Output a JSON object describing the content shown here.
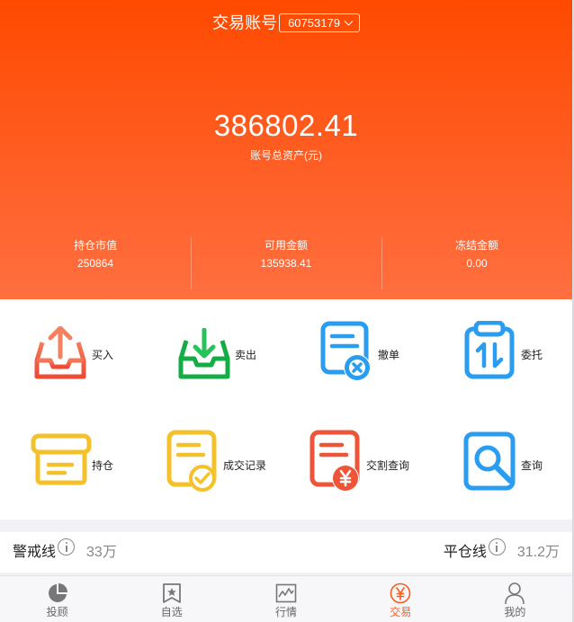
{
  "header": {
    "title": "交易账号",
    "account_number": "60753179"
  },
  "assets": {
    "total_value": "386802.41",
    "total_label": "账号总资产(元)",
    "stats": [
      {
        "label": "持仓市值",
        "value": "250864"
      },
      {
        "label": "可用金额",
        "value": "135938.41"
      },
      {
        "label": "冻结金额",
        "value": "0.00"
      }
    ]
  },
  "actions": [
    {
      "label": "买入",
      "icon": "buy-tray-up-icon",
      "color": "#f05a3c"
    },
    {
      "label": "卖出",
      "icon": "sell-tray-down-icon",
      "color": "#1fb44a"
    },
    {
      "label": "撤单",
      "icon": "cancel-order-icon",
      "color": "#2a9df0"
    },
    {
      "label": "委托",
      "icon": "entrust-clipboard-icon",
      "color": "#2a9df0"
    },
    {
      "label": "持仓",
      "icon": "holdings-box-icon",
      "color": "#f5c12a"
    },
    {
      "label": "成交记录",
      "icon": "trade-record-icon",
      "color": "#f5c12a"
    },
    {
      "label": "交割查询",
      "icon": "settlement-query-icon",
      "color": "#ee5538"
    },
    {
      "label": "查询",
      "icon": "search-query-icon",
      "color": "#2a9df0"
    }
  ],
  "risk_lines": {
    "warning_label": "警戒线",
    "warning_value": "33万",
    "liquidation_label": "平仓线",
    "liquidation_value": "31.2万"
  },
  "tabbar": {
    "active": "交易",
    "accent": "#ff5a1e",
    "items": [
      {
        "label": "投顾",
        "icon": "pie-chart-icon"
      },
      {
        "label": "自选",
        "icon": "bookmark-star-icon"
      },
      {
        "label": "行情",
        "icon": "market-chart-icon"
      },
      {
        "label": "交易",
        "icon": "yen-circle-icon"
      },
      {
        "label": "我的",
        "icon": "user-icon"
      }
    ]
  }
}
